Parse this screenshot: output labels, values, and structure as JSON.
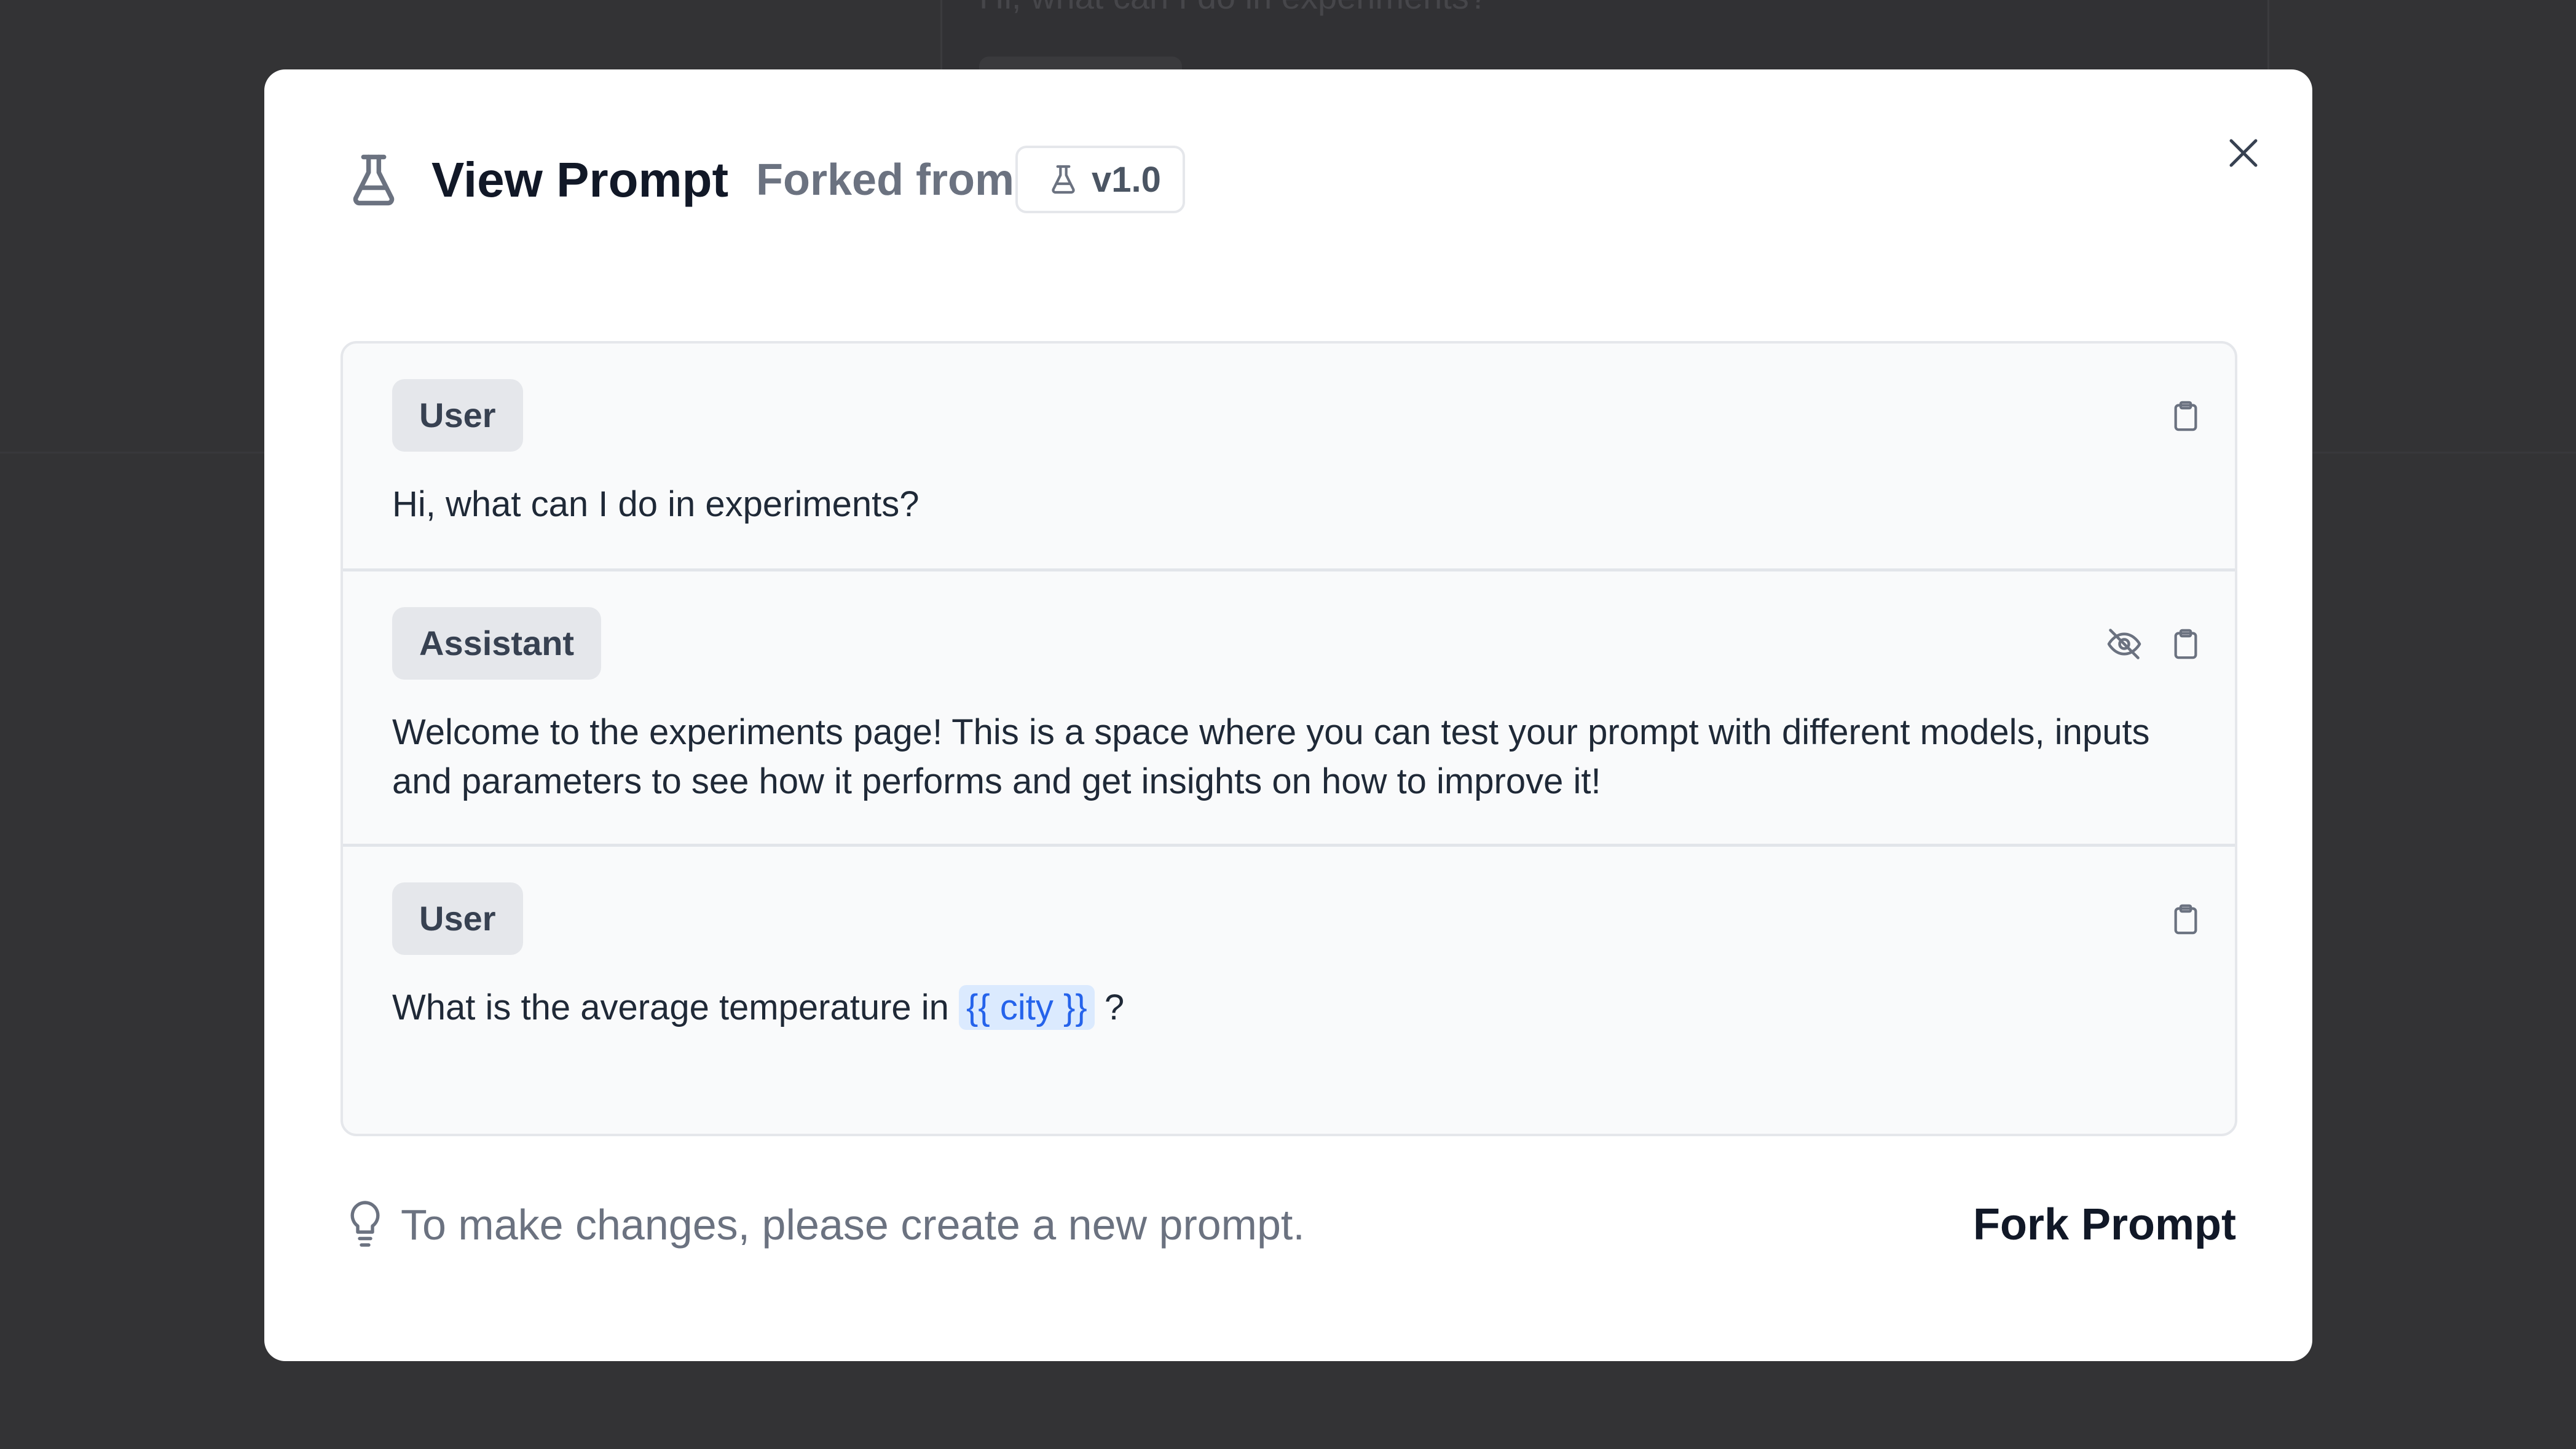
{
  "background": {
    "partial_text": "Hi, what can I do in experiments?"
  },
  "modal": {
    "title": "View Prompt",
    "forked_from_label": "Forked from",
    "forked_version": "v1.0",
    "header_icon": "flask-icon",
    "close_icon": "close-icon"
  },
  "messages": [
    {
      "role": "User",
      "text": "Hi, what can I do in experiments?",
      "actions": [
        "clipboard-icon"
      ]
    },
    {
      "role": "Assistant",
      "text": "Welcome to the experiments page! This is a space where you can test your prompt with different models, inputs and parameters to see how it performs and get insights on how to improve it!",
      "actions": [
        "eye-off-icon",
        "clipboard-icon"
      ]
    },
    {
      "role": "User",
      "text_before": "What is the average temperature in",
      "variable": "{{ city }}",
      "text_after": "?",
      "actions": [
        "clipboard-icon"
      ]
    }
  ],
  "footer": {
    "hint_icon": "lightbulb-icon",
    "hint": "To make changes, please create a new prompt.",
    "fork_button_label": "Fork Prompt"
  },
  "colors": {
    "overlay": "#333335",
    "modal_bg": "#ffffff",
    "variable_chip_bg": "#dbeafe",
    "variable_chip_text": "#2563eb",
    "badge_bg": "#e5e7eb"
  }
}
